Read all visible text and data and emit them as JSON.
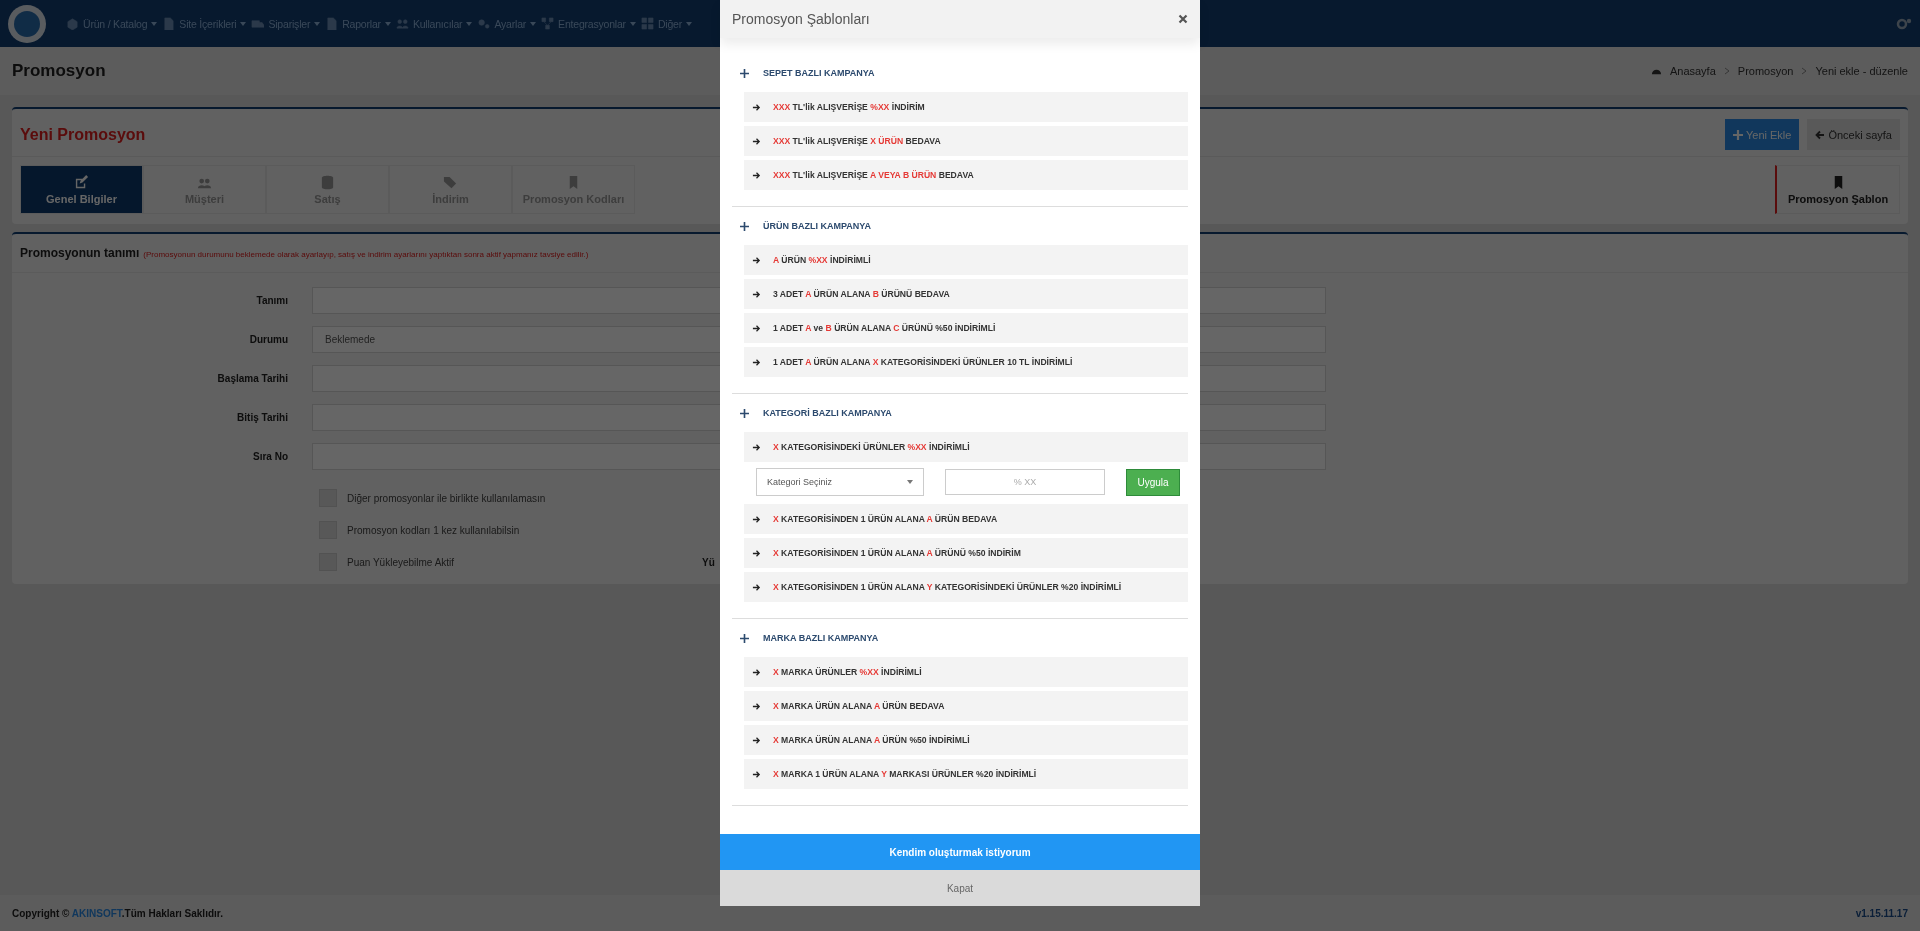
{
  "navbar": {
    "items": [
      {
        "label": "Ürün / Katalog"
      },
      {
        "label": "Site İçerikleri"
      },
      {
        "label": "Siparişler"
      },
      {
        "label": "Raporlar"
      },
      {
        "label": "Kullanıcılar"
      },
      {
        "label": "Ayarlar"
      },
      {
        "label": "Entegrasyonlar"
      },
      {
        "label": "Diğer"
      }
    ]
  },
  "page_title": "Promosyon",
  "breadcrumb": [
    "Anasayfa",
    "Promosyon",
    "Yeni ekle - düzenle"
  ],
  "card": {
    "title": "Yeni Promosyon",
    "buttons": [
      {
        "label": "Yeni Ekle",
        "kind": "primary"
      },
      {
        "label": "Önceki sayfa",
        "kind": "back"
      }
    ],
    "tabs": [
      {
        "label": "Genel Bilgiler",
        "selected": true
      },
      {
        "label": "Müşteri",
        "selected": false
      },
      {
        "label": "Satış",
        "selected": false
      },
      {
        "label": "İndirim",
        "selected": false
      },
      {
        "label": "Promosyon Kodları",
        "selected": false
      }
    ],
    "template_tab": {
      "label": "Promosyon Şablon"
    }
  },
  "form": {
    "title": "Promosyonun tanımı",
    "note": "(Promosyonun durumunu beklemede olarak ayarlayıp, satış ve indirim ayarlarını yaptıktan sonra aktif yapmanız tavsiye edilir.)",
    "fields": [
      {
        "label": "Tanımı",
        "kind": "text"
      },
      {
        "label": "Durumu",
        "kind": "select",
        "value": "Beklemede"
      },
      {
        "label": "Başlama Tarihi",
        "kind": "text"
      },
      {
        "label": "Bitiş Tarihi",
        "kind": "text"
      },
      {
        "label": "Sıra No",
        "kind": "text"
      }
    ],
    "checkboxes": [
      {
        "label": "Diğer promosyonlar ile birlikte kullanılamasın",
        "checked": false
      },
      {
        "label": "Promosyon kodları 1 kez kullanılabilsin",
        "checked": false
      },
      {
        "label": "Puan Yükleyebilme Aktif",
        "checked": false
      }
    ],
    "side_label": "Yü"
  },
  "modal": {
    "title": "Promosyon Şablonları",
    "sections": [
      {
        "title": "SEPET BAZLI KAMPANYA",
        "items": [
          {
            "parts": [
              {
                "text": "XXX",
                "highlight": true
              },
              {
                "text": " TL'lik ALIŞVERİŞE ",
                "highlight": false
              },
              {
                "text": "%XX",
                "highlight": true
              },
              {
                "text": " İNDİRİM",
                "highlight": false
              }
            ]
          },
          {
            "parts": [
              {
                "text": "XXX",
                "highlight": true
              },
              {
                "text": " TL'lik ALIŞVERİŞE ",
                "highlight": false
              },
              {
                "text": "X ÜRÜN",
                "highlight": true
              },
              {
                "text": " BEDAVA",
                "highlight": false
              }
            ]
          },
          {
            "parts": [
              {
                "text": "XXX",
                "highlight": true
              },
              {
                "text": " TL'lik ALIŞVERİŞE ",
                "highlight": false
              },
              {
                "text": "A VEYA B ÜRÜN",
                "highlight": true
              },
              {
                "text": " BEDAVA",
                "highlight": false
              }
            ]
          }
        ]
      },
      {
        "title": "ÜRÜN BAZLI KAMPANYA",
        "items": [
          {
            "parts": [
              {
                "text": "A",
                "highlight": true
              },
              {
                "text": " ÜRÜN ",
                "highlight": false
              },
              {
                "text": "%XX",
                "highlight": true
              },
              {
                "text": " İNDİRİMLİ",
                "highlight": false
              }
            ]
          },
          {
            "parts": [
              {
                "text": "3 ADET ",
                "highlight": false
              },
              {
                "text": "A",
                "highlight": true
              },
              {
                "text": " ÜRÜN ALANA ",
                "highlight": false
              },
              {
                "text": "B",
                "highlight": true
              },
              {
                "text": " ÜRÜNÜ BEDAVA",
                "highlight": false
              }
            ]
          },
          {
            "parts": [
              {
                "text": "1 ADET ",
                "highlight": false
              },
              {
                "text": "A",
                "highlight": true
              },
              {
                "text": " ve ",
                "highlight": false
              },
              {
                "text": "B",
                "highlight": true
              },
              {
                "text": " ÜRÜN ALANA ",
                "highlight": false
              },
              {
                "text": "C",
                "highlight": true
              },
              {
                "text": " ÜRÜNÜ %50 İNDİRİMLİ",
                "highlight": false
              }
            ]
          },
          {
            "parts": [
              {
                "text": "1 ADET ",
                "highlight": false
              },
              {
                "text": "A",
                "highlight": true
              },
              {
                "text": " ÜRÜN ALANA ",
                "highlight": false
              },
              {
                "text": "X",
                "highlight": true
              },
              {
                "text": " KATEGORİSİNDEKİ ÜRÜNLER 10 TL İNDİRİMLİ",
                "highlight": false
              }
            ]
          }
        ]
      },
      {
        "title": "KATEGORİ BAZLI KAMPANYA",
        "items": [
          {
            "parts": [
              {
                "text": "X",
                "highlight": true
              },
              {
                "text": " KATEGORİSİNDEKİ ÜRÜNLER ",
                "highlight": false
              },
              {
                "text": "%XX",
                "highlight": true
              },
              {
                "text": " İNDİRİMLİ",
                "highlight": false
              }
            ],
            "filter": {
              "select": "Kategori Seçiniz",
              "placeholder": "% XX",
              "button": "Uygula"
            }
          },
          {
            "parts": [
              {
                "text": "X",
                "highlight": true
              },
              {
                "text": " KATEGORİSİNDEN 1 ÜRÜN ALANA ",
                "highlight": false
              },
              {
                "text": "A",
                "highlight": true
              },
              {
                "text": " ÜRÜN BEDAVA",
                "highlight": false
              }
            ]
          },
          {
            "parts": [
              {
                "text": "X",
                "highlight": true
              },
              {
                "text": " KATEGORİSİNDEN 1 ÜRÜN ALANA ",
                "highlight": false
              },
              {
                "text": "A",
                "highlight": true
              },
              {
                "text": " ÜRÜNÜ %50 İNDİRİM",
                "highlight": false
              }
            ]
          },
          {
            "parts": [
              {
                "text": "X",
                "highlight": true
              },
              {
                "text": " KATEGORİSİNDEN 1 ÜRÜN ALANA ",
                "highlight": false
              },
              {
                "text": "Y",
                "highlight": true
              },
              {
                "text": " KATEGORİSİNDEKİ ÜRÜNLER %20 İNDİRİMLİ",
                "highlight": false
              }
            ]
          }
        ]
      },
      {
        "title": "MARKA BAZLI KAMPANYA",
        "items": [
          {
            "parts": [
              {
                "text": "X",
                "highlight": true
              },
              {
                "text": " MARKA ÜRÜNLER ",
                "highlight": false
              },
              {
                "text": "%XX",
                "highlight": true
              },
              {
                "text": " İNDİRİMLİ",
                "highlight": false
              }
            ]
          },
          {
            "parts": [
              {
                "text": "X",
                "highlight": true
              },
              {
                "text": " MARKA ÜRÜN ALANA ",
                "highlight": false
              },
              {
                "text": "A",
                "highlight": true
              },
              {
                "text": " ÜRÜN BEDAVA",
                "highlight": false
              }
            ]
          },
          {
            "parts": [
              {
                "text": "X",
                "highlight": true
              },
              {
                "text": " MARKA ÜRÜN ALANA ",
                "highlight": false
              },
              {
                "text": "A",
                "highlight": true
              },
              {
                "text": " ÜRÜN %50 İNDİRİMLİ",
                "highlight": false
              }
            ]
          },
          {
            "parts": [
              {
                "text": "X",
                "highlight": true
              },
              {
                "text": " MARKA 1 ÜRÜN ALANA ",
                "highlight": false
              },
              {
                "text": "Y",
                "highlight": true
              },
              {
                "text": " MARKASI ÜRÜNLER %20 İNDİRİMLİ",
                "highlight": false
              }
            ]
          }
        ]
      }
    ],
    "primary_button": "Kendim oluşturmak istiyorum",
    "close_button": "Kapat"
  },
  "footer": {
    "copyright": "Copyright ©",
    "brand": "AKINSOFT",
    "rights": ".Tüm Hakları Saklıdır.",
    "version": "v1.15.11.17"
  }
}
